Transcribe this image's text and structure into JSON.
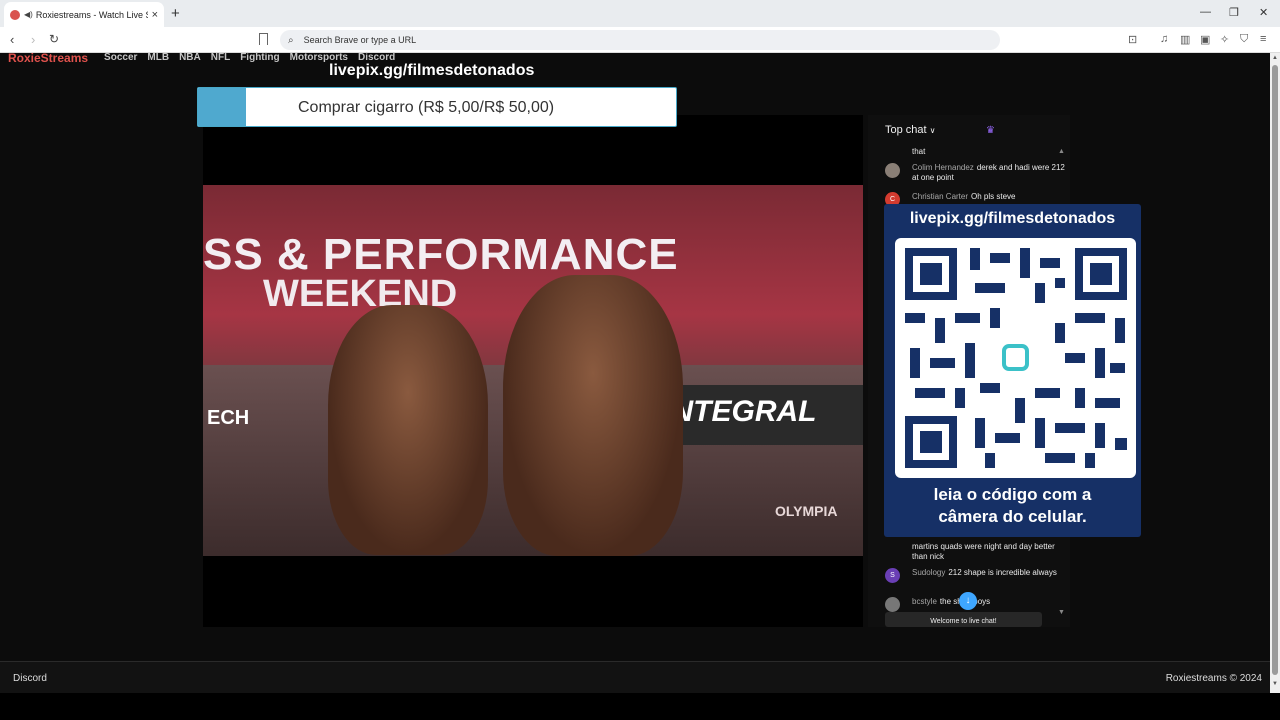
{
  "browser": {
    "tab_title": "Roxiestreams - Watch Live Sp",
    "tab_close": "×",
    "new_tab": "+",
    "url_placeholder": "Search Brave or type a URL",
    "window_minimize": "—",
    "window_restore": "❐",
    "window_close": "✕"
  },
  "site": {
    "brand": "RoxieStreams",
    "nav": [
      "Soccer",
      "MLB",
      "NBA",
      "NFL",
      "Fighting",
      "Motorsports",
      "Discord"
    ]
  },
  "overlay": {
    "title": "livepix.gg/filmesdetonados",
    "donate_label": "Comprar cigarro (R$ 5,00/R$ 50,00)",
    "donate_progress_fraction": 0.1
  },
  "video": {
    "banner_line1": "SS & PERFORMANCE",
    "banner_line2": "WEEKEND",
    "sponsor": "INTEGRAL",
    "left_sponsor": "ECH",
    "watermark": "OLYMPIA"
  },
  "chat": {
    "header": "Top chat",
    "messages": [
      {
        "author": "",
        "text": "that",
        "avatar_color": "",
        "initial": ""
      },
      {
        "author": "Colim Hernandez",
        "text": "derek and hadi were 212 at one point",
        "avatar_color": "#8a7f76",
        "initial": ""
      },
      {
        "author": "Christian Carter",
        "text": "Oh pls steve",
        "avatar_color": "#d33b2f",
        "initial": "C"
      },
      {
        "author": "",
        "text": "martins quads were night and day better than nick",
        "avatar_color": "",
        "initial": ""
      },
      {
        "author": "Sudology",
        "text": "212 shape is incredible always",
        "avatar_color": "#6a3fb5",
        "initial": "S"
      },
      {
        "author": "bcstyle",
        "text": "the short boys",
        "avatar_color": "#777777",
        "initial": ""
      }
    ],
    "welcome": "Welcome to live chat!"
  },
  "qr_card": {
    "url": "livepix.gg/filmesdetonados",
    "caption_line1": "leia o código com a",
    "caption_line2": "câmera do celular."
  },
  "footer": {
    "left": "Discord",
    "right": "Roxiestreams © 2024"
  }
}
